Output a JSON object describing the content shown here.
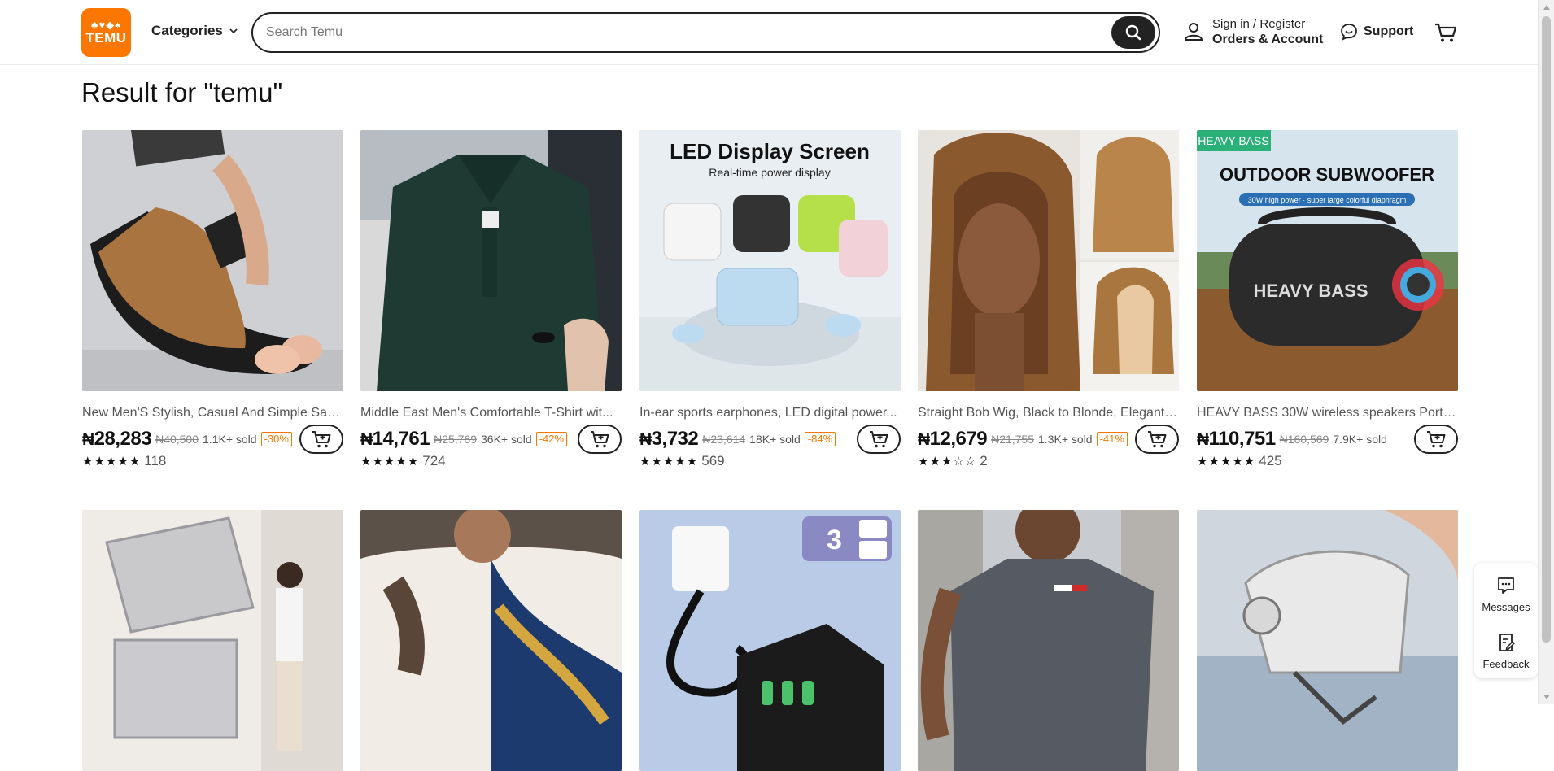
{
  "header": {
    "logo_top": "♣♥◆♠",
    "logo_text": "TEMU",
    "categories_label": "Categories",
    "search_placeholder": "Search Temu",
    "account_line1": "Sign in / Register",
    "account_line2": "Orders & Account",
    "support_label": "Support"
  },
  "page_title": "Result for \"temu\"",
  "products": [
    {
      "title": "New Men'S Stylish, Casual And Simple San...",
      "currency": "₦",
      "price": "28,283",
      "old_price": "₦40,500",
      "sold": "1.1K+ sold",
      "discount": "-30%",
      "stars": "★★★★★",
      "reviews": "118"
    },
    {
      "title": "Middle East Men's Comfortable T-Shirt wit...",
      "currency": "₦",
      "price": "14,761",
      "old_price": "₦25,769",
      "sold": "36K+ sold",
      "discount": "-42%",
      "stars": "★★★★★",
      "reviews": "724"
    },
    {
      "title": "In-ear sports earphones, LED digital power...",
      "currency": "₦",
      "price": "3,732",
      "old_price": "₦23,614",
      "sold": "18K+ sold",
      "discount": "-84%",
      "stars": "★★★★★",
      "reviews": "569",
      "image_heading": "LED Display Screen",
      "image_sub": "Real-time power display"
    },
    {
      "title": "Straight Bob Wig, Black to Blonde, Elegant ...",
      "currency": "₦",
      "price": "12,679",
      "old_price": "₦21,755",
      "sold": "1.3K+ sold",
      "discount": "-41%",
      "stars": "★★★☆☆",
      "reviews": "2"
    },
    {
      "title": "HEAVY BASS 30W wireless speakers Portab...",
      "currency": "₦",
      "price": "110,751",
      "old_price": "₦160,569",
      "sold": "7.9K+ sold",
      "discount": "",
      "stars": "★★★★★",
      "reviews": "425",
      "image_tag": "HEAVY BASS",
      "image_heading": "OUTDOOR SUBWOOFER",
      "image_sub": "30W high power · super large colorful diaphragm",
      "image_brand": "HEAVY BASS"
    }
  ],
  "side_panel": {
    "messages_label": "Messages",
    "feedback_label": "Feedback"
  },
  "colors": {
    "brand": "#fb7701",
    "text": "#222222",
    "muted": "#555555"
  }
}
